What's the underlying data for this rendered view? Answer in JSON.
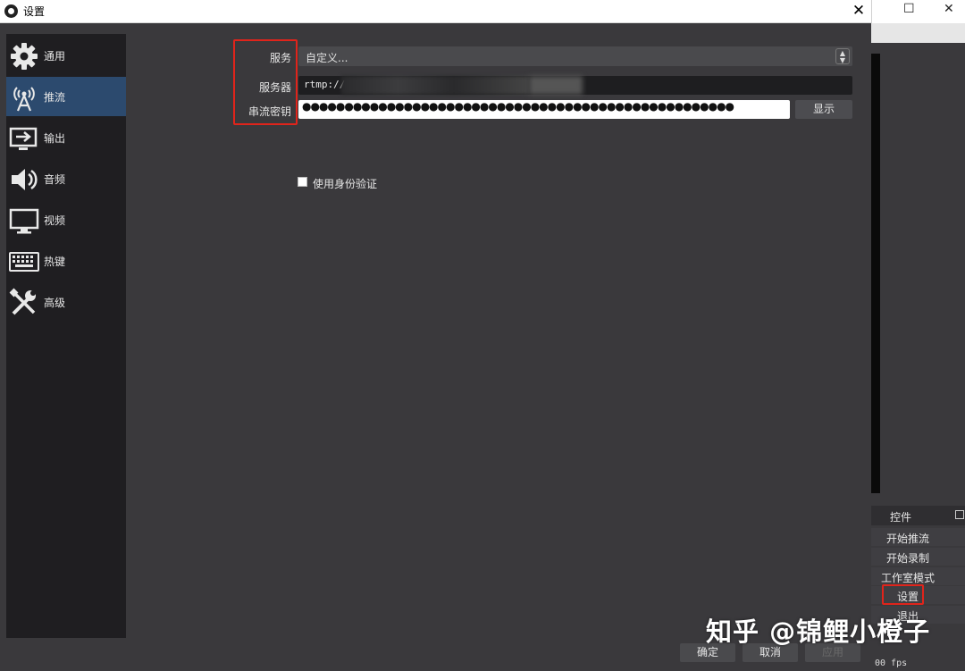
{
  "window": {
    "title": "设置"
  },
  "sidebar": {
    "items": [
      {
        "label": "通用",
        "icon": "gear-icon"
      },
      {
        "label": "推流",
        "icon": "broadcast-tower-icon",
        "active": true
      },
      {
        "label": "输出",
        "icon": "output-monitor-icon"
      },
      {
        "label": "音频",
        "icon": "speaker-icon"
      },
      {
        "label": "视频",
        "icon": "monitor-icon"
      },
      {
        "label": "热键",
        "icon": "keyboard-icon"
      },
      {
        "label": "高级",
        "icon": "wrench-screwdriver-icon"
      }
    ]
  },
  "stream": {
    "service_label": "服务",
    "service_value": "自定义...",
    "server_label": "服务器",
    "server_value": "rtmp://",
    "key_label": "串流密钥",
    "key_value": "●●●●●●●●●●●●●●●●●●●●●●●●●●●●●●●●●●●●●●●●●●●●●●●●●●●",
    "show_button": "显示",
    "auth_label": "使用身份验证",
    "auth_checked": false
  },
  "footer": {
    "ok": "确定",
    "cancel": "取消",
    "apply": "应用"
  },
  "main_window": {
    "controls_title": "控件",
    "buttons": [
      "开始推流",
      "开始录制",
      "工作室模式",
      "设置",
      "退出"
    ],
    "fps": "00 fps"
  },
  "watermark": "知乎 @锦鲤小橙子",
  "colors": {
    "highlight": "#e0241b",
    "active_nav": "#2c4a6e",
    "background": "#3a393c",
    "sidebar": "#1f1e21"
  }
}
